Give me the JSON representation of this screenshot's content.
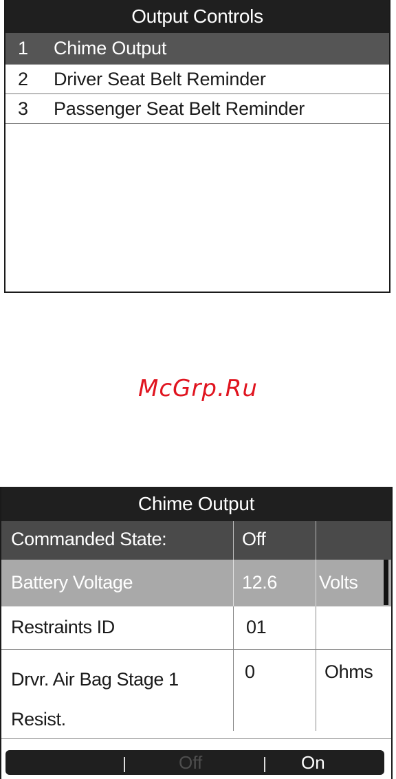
{
  "output_controls": {
    "title": "Output Controls",
    "items": [
      {
        "num": "1",
        "label": "Chime Output",
        "selected": true
      },
      {
        "num": "2",
        "label": "Driver Seat Belt Reminder",
        "selected": false
      },
      {
        "num": "3",
        "label": "Passenger Seat Belt Reminder",
        "selected": false
      }
    ]
  },
  "watermark": "McGrp.Ru",
  "chime_output": {
    "title": "Chime Output",
    "rows": [
      {
        "name": "Commanded State:",
        "value": "Off",
        "unit": ""
      },
      {
        "name": "Battery Voltage",
        "value": "12.6",
        "unit": "Volts"
      },
      {
        "name": "Restraints ID",
        "value": "01",
        "unit": ""
      },
      {
        "name": "Drvr. Air Bag Stage 1",
        "name_line2": "Resist.",
        "value": "0",
        "unit": "Ohms"
      }
    ],
    "bottom_bar": {
      "off_label": "Off",
      "on_label": "On"
    }
  },
  "colors": {
    "title_bar": "#1f1f1f",
    "selected_row": "#555555",
    "commanded_row": "#4a4a4a",
    "highlight_row": "#a9a9a9",
    "watermark": "#e0141f",
    "disabled_option": "#4e4e4e"
  }
}
